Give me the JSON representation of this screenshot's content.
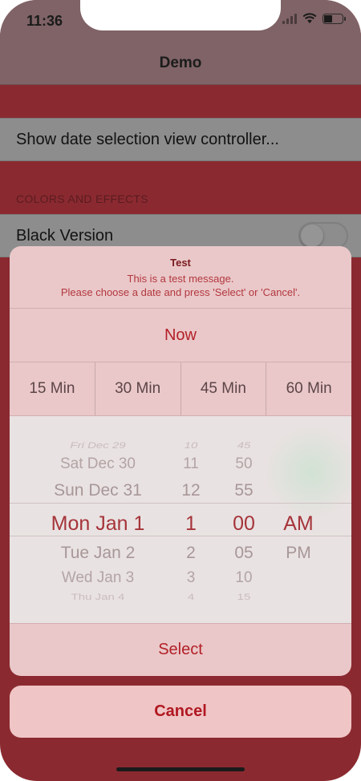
{
  "status_bar": {
    "time": "11:36"
  },
  "nav": {
    "title": "Demo"
  },
  "list": {
    "show_date_row": "Show date selection view controller...",
    "section_colors": "COLORS AND EFFECTS",
    "black_version": "Black Version"
  },
  "sheet": {
    "title": "Test",
    "message_line1": "This is a test message.",
    "message_line2": "Please choose a date and press 'Select' or 'Cancel'.",
    "now_label": "Now",
    "quick_buttons": [
      "15 Min",
      "30 Min",
      "45 Min",
      "60 Min"
    ],
    "picker": {
      "dates": [
        "Fri Dec 29",
        "Sat Dec 30",
        "Sun Dec 31",
        "Mon Jan 1",
        "Tue Jan 2",
        "Wed Jan 3",
        "Thu Jan 4"
      ],
      "hours": [
        "10",
        "11",
        "12",
        "1",
        "2",
        "3",
        "4"
      ],
      "minutes": [
        "45",
        "50",
        "55",
        "00",
        "05",
        "10",
        "15"
      ],
      "ampm": [
        "AM",
        "PM"
      ],
      "selected": {
        "date": "Mon Jan 1",
        "hour": "1",
        "minute": "00",
        "ampm": "AM"
      }
    },
    "select_label": "Select",
    "cancel_label": "Cancel"
  },
  "colors": {
    "accent": "#b32028",
    "background": "#8a2a30",
    "sheet": "#eac8c9"
  }
}
